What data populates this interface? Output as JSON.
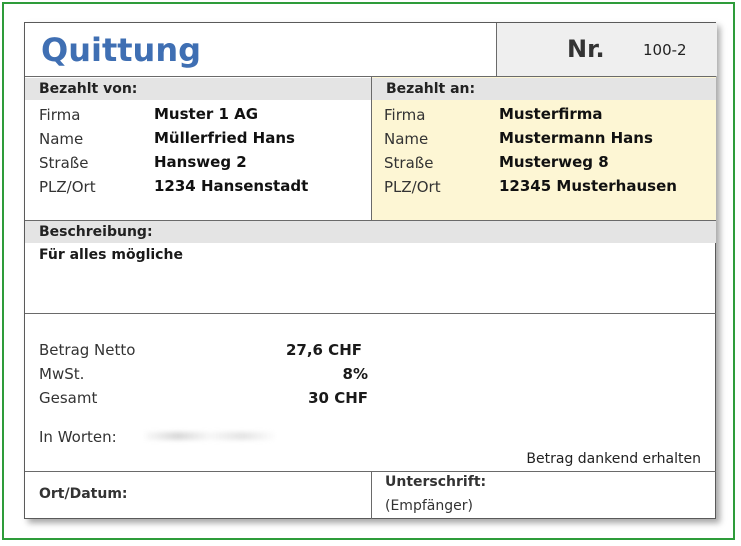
{
  "header": {
    "title": "Quittung",
    "nr_label": "Nr.",
    "nr_value": "100-2"
  },
  "paid_by": {
    "heading": "Bezahlt von:",
    "rows": [
      {
        "label": "Firma",
        "value": "Muster 1 AG"
      },
      {
        "label": "Name",
        "value": "Müllerfried Hans"
      },
      {
        "label": "Straße",
        "value": "Hansweg 2"
      },
      {
        "label": "PLZ/Ort",
        "value": "1234 Hansenstadt"
      }
    ]
  },
  "paid_to": {
    "heading": "Bezahlt an:",
    "rows": [
      {
        "label": "Firma",
        "value": "Musterfirma"
      },
      {
        "label": "Name",
        "value": "Mustermann Hans"
      },
      {
        "label": "Straße",
        "value": "Musterweg 8"
      },
      {
        "label": "PLZ/Ort",
        "value": "12345 Musterhausen"
      }
    ]
  },
  "description": {
    "heading": "Beschreibung:",
    "text": "Für alles mögliche"
  },
  "amounts": {
    "rows": [
      {
        "label": "Betrag Netto",
        "value": "27,6 CHF"
      },
      {
        "label": "MwSt.",
        "value": "8%"
      },
      {
        "label": "Gesamt",
        "value": "30 CHF"
      }
    ],
    "in_words_label": "In Worten:",
    "thanks": "Betrag dankend erhalten"
  },
  "footer": {
    "place_date": "Ort/Datum:",
    "signature": "Unterschrift:",
    "recipient": "(Empfänger)"
  },
  "colors": {
    "title": "#3f6fb3",
    "frame": "#2e9c3a",
    "paid_to_bg": "#fdf6d4",
    "section_head_bg": "#e4e4e4"
  }
}
